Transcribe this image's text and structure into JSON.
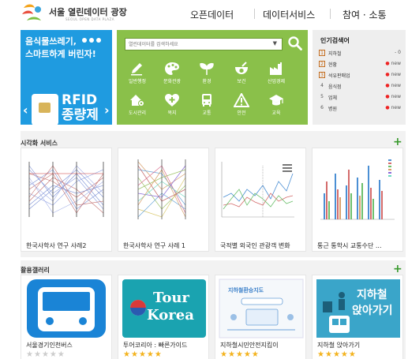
{
  "header": {
    "logo_title": "서울 열린데이터 광장",
    "logo_sub": "SEOUL OPEN DATA PLAZA",
    "nav": [
      "오픈데이터",
      "데이터서비스",
      "참여 · 소통"
    ]
  },
  "promo": {
    "line1": "음식물쓰레기,",
    "line2": "스마트하게 버린자!",
    "big1": "RFID",
    "big2": "종량제",
    "prev": "‹",
    "next": "›"
  },
  "search": {
    "placeholder": "열린데이터를 검색하세요",
    "categories": [
      "일반행정",
      "문화관광",
      "환경",
      "보건",
      "산업경제",
      "도시관리",
      "복지",
      "교통",
      "안전",
      "교육"
    ]
  },
  "popular": {
    "title": "인기검색어",
    "items": [
      {
        "rank": "1",
        "name": "지하철",
        "status": "- 0",
        "is_new": false
      },
      {
        "rank": "2",
        "name": "현황",
        "status": "new",
        "is_new": true
      },
      {
        "rank": "3",
        "name": "석유판매업",
        "status": "new",
        "is_new": true
      },
      {
        "rank": "4",
        "name": "음식점",
        "status": "new",
        "is_new": true
      },
      {
        "rank": "5",
        "name": "업체",
        "status": "new",
        "is_new": true
      },
      {
        "rank": "6",
        "name": "병원",
        "status": "new",
        "is_new": true
      }
    ]
  },
  "visual": {
    "title": "시각화 서비스",
    "plus": "+",
    "items": [
      "한국사학사 연구 사례2",
      "한국사학사 연구 사례 1",
      "국적별 외국인 관광객 변화",
      "통근 통학시 교통수단 ..."
    ]
  },
  "gallery": {
    "title": "활용갤러리",
    "plus": "+",
    "tour_line1": "Tour",
    "tour_line2": "Korea",
    "banner_top": "지하철환승지도",
    "subway_line1": "지하철",
    "subway_line2": "앉아가기",
    "items": [
      {
        "name": "서울경기인천버스",
        "rating": 0
      },
      {
        "name": "투어코리아 : 빠른가이드",
        "rating": 5
      },
      {
        "name": "지하철시민안전지킴이",
        "rating": 5
      },
      {
        "name": "지하철 앉아가기",
        "rating": 5
      }
    ]
  },
  "colors": {
    "promo_blue": "#1f9be0",
    "search_green": "#8ac04a",
    "plus_green": "#3a9a2e",
    "star_gold": "#f3b21c"
  }
}
